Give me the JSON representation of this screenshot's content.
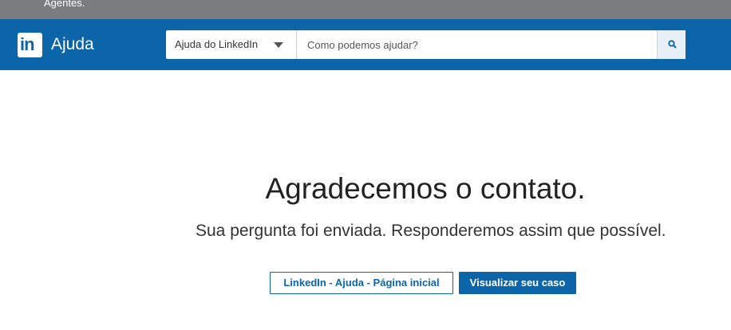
{
  "top_strip": {
    "text": "Agentes."
  },
  "header": {
    "logo_text": "in",
    "brand": "Ajuda",
    "search": {
      "scope_label": "Ajuda do LinkedIn",
      "placeholder": "Como podemos ajudar?",
      "value": ""
    }
  },
  "main": {
    "headline": "Agradecemos o contato.",
    "subtext": "Sua pergunta foi enviada. Responderemos assim que possível.",
    "buttons": {
      "home": "LinkedIn - Ajuda - Página inicial",
      "view_case": "Visualizar seu caso"
    }
  },
  "colors": {
    "brand_blue": "#0b65a8",
    "top_strip": "#7a7d80"
  }
}
